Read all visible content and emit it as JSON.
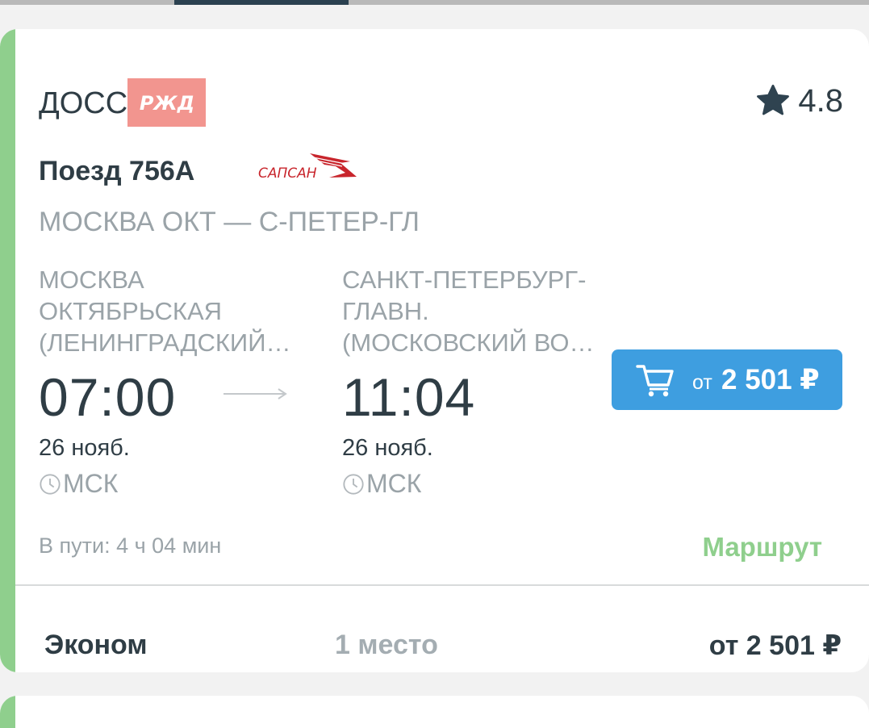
{
  "colors": {
    "accent_green": "#8fcf8d",
    "primary_button": "#3e9ee0",
    "dark_text": "#2f3d45",
    "muted_text": "#9aa3a8",
    "rzd_logo_bg": "#f2958f"
  },
  "card": {
    "carrier": "ДОСС",
    "carrier_logo_text": "РЖД",
    "rating": "4.8",
    "train": "Поезд 756А",
    "brand_logo_text": "САПСАН",
    "route": "МОСКВА ОКТ — С-ПЕТЕР-ГЛ",
    "departure": {
      "station": "МОСКВА ОКТЯБРЬСКАЯ (ЛЕНИНГРАДСКИЙ…",
      "time": "07:00",
      "date": "26 нояб.",
      "timezone": "МСК"
    },
    "arrival": {
      "station": "САНКТ-ПЕТЕРБУРГ-ГЛАВН. (МОСКОВСКИЙ ВО…",
      "time": "11:04",
      "date": "26 нояб.",
      "timezone": "МСК"
    },
    "buy_button": {
      "from": "от",
      "price": "2 501 ₽"
    },
    "duration": "В пути: 4 ч 04 мин",
    "route_link": "Маршрут",
    "fare": {
      "class": "Эконом",
      "seats": "1 место",
      "price": "от 2 501 ₽"
    }
  },
  "icons": [
    "star-icon",
    "arrow-right-icon",
    "clock-icon",
    "cart-icon"
  ]
}
